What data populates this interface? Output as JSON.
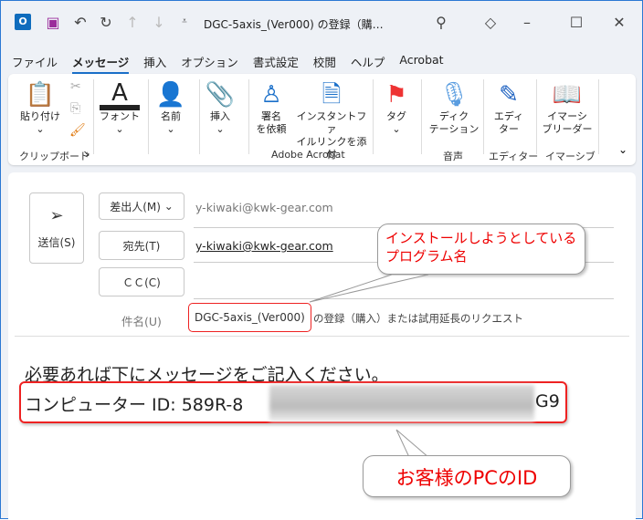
{
  "titlebar": {
    "title": "DGC-5axis_(Ver000) の登録（購…"
  },
  "tabs": [
    "ファイル",
    "メッセージ",
    "挿入",
    "オプション",
    "書式設定",
    "校閲",
    "ヘルプ",
    "Acrobat"
  ],
  "ribbon": {
    "paste": "貼り付け",
    "font": "フォント",
    "name": "名前",
    "insert": "挿入",
    "sign1": "署名",
    "sign2": "を依頼",
    "link1": "インスタントファ",
    "link2": "イルリンクを添付",
    "tag": "タグ",
    "dict1": "ディク",
    "dict2": "テーション",
    "editor1": "エディ",
    "editor2": "ター",
    "reader1": "イマーシ",
    "reader2": "ブリーダー",
    "groups": {
      "clipboard": "クリップボード",
      "acrobat": "Adobe Acrobat",
      "voice": "音声",
      "editor": "エディター",
      "immersive": "イマーシブ"
    }
  },
  "compose": {
    "send": "送信(S)",
    "from_label": "差出人(M)",
    "from": "y-kiwaki@kwk-gear.com",
    "to_label": "宛先(T)",
    "to": "y-kiwaki@kwk-gear.com",
    "cc_label": "ＣＣ(C)",
    "subject_label": "件名(U)",
    "subject_highlight": "DGC-5axis_(Ver000)",
    "subject_rest": "の登録（購入）または試用延長のリクエスト",
    "body_line1": "必要あれば下にメッセージをご記入ください。",
    "body_id_prefix": "コンピューター ID: 589R-8",
    "body_id_suffix": "G9"
  },
  "callouts": {
    "program": "インストールしようとしている\nプログラム名",
    "pcid": "お客様のPCのID"
  }
}
